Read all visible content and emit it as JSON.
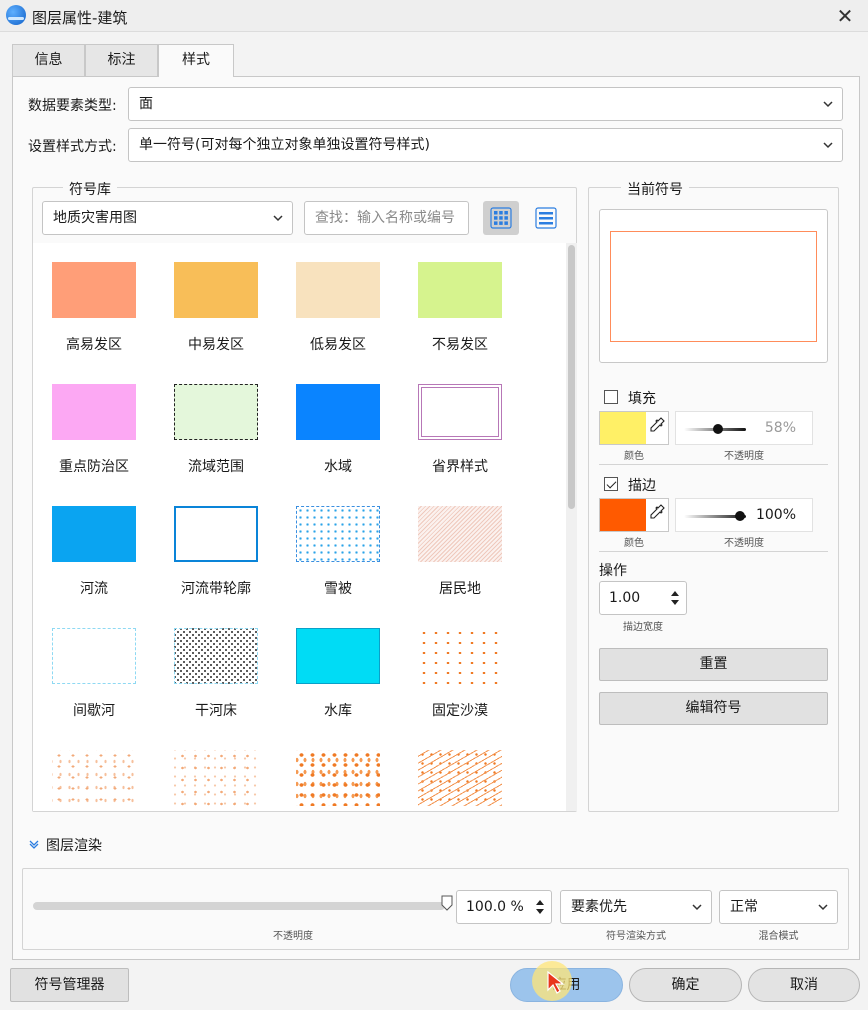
{
  "window": {
    "title": "图层属性-建筑",
    "close_icon": "close-icon"
  },
  "tabs": [
    {
      "label": "信息"
    },
    {
      "label": "标注"
    },
    {
      "label": "样式",
      "active": true
    }
  ],
  "form": {
    "data_type_label": "数据要素类型:",
    "data_type_value": "面",
    "style_mode_label": "设置样式方式:",
    "style_mode_value": "单一符号(可对每个独立对象单独设置符号样式)"
  },
  "library": {
    "title": "符号库",
    "category": "地质灾害用图",
    "search_placeholder": "查找：输入名称或编号",
    "symbols": [
      {
        "label": "高易发区",
        "fill": "#ff9e78"
      },
      {
        "label": "中易发区",
        "fill": "#f8be58"
      },
      {
        "label": "低易发区",
        "fill": "#f8e2be"
      },
      {
        "label": "不易发区",
        "fill": "#d6f38e"
      },
      {
        "label": "重点防治区",
        "fill": "#fca8f3"
      },
      {
        "label": "流域范围",
        "fill": "#e4f7db"
      },
      {
        "label": "水域",
        "fill": "#0a84ff"
      },
      {
        "label": "省界样式",
        "fill": "#ffffff"
      },
      {
        "label": "河流",
        "fill": "#0aa4f1"
      },
      {
        "label": "河流带轮廓",
        "fill": "#ffffff"
      },
      {
        "label": "雪被",
        "fill": "#ffffff"
      },
      {
        "label": "居民地",
        "fill": "#fbf1ee"
      },
      {
        "label": "间歇河",
        "fill": "#ffffff"
      },
      {
        "label": "干河床",
        "fill": "#ffffff"
      },
      {
        "label": "水库",
        "fill": "#00dcf5"
      },
      {
        "label": "固定沙漠",
        "fill": "#ffffff"
      },
      {
        "label": "",
        "fill": "#ffffff"
      },
      {
        "label": "",
        "fill": "#ffffff"
      },
      {
        "label": "",
        "fill": "#ffffff"
      },
      {
        "label": "",
        "fill": "#ffffff"
      }
    ]
  },
  "current": {
    "title": "当前符号",
    "fill_label": "填充",
    "fill_checked": false,
    "fill_color": "#fff066",
    "fill_opacity": "58%",
    "fill_opacity_value": 0.58,
    "color_caption": "颜色",
    "opacity_caption": "不透明度",
    "stroke_label": "描边",
    "stroke_checked": true,
    "stroke_color": "#ff5a00",
    "stroke_opacity": "100%",
    "stroke_opacity_value": 1.0,
    "op_label": "操作",
    "stroke_width": "1.00",
    "stroke_width_caption": "描边宽度",
    "reset_label": "重置",
    "edit_label": "编辑符号"
  },
  "render": {
    "title": "图层渲染",
    "opacity_value": "100.0 %",
    "opacity_caption": "不透明度",
    "render_mode": "要素优先",
    "render_mode_caption": "符号渲染方式",
    "blend": "正常",
    "blend_caption": "混合模式"
  },
  "footer": {
    "manager_label": "符号管理器",
    "apply_label": "应用",
    "ok_label": "确定",
    "cancel_label": "取消"
  }
}
